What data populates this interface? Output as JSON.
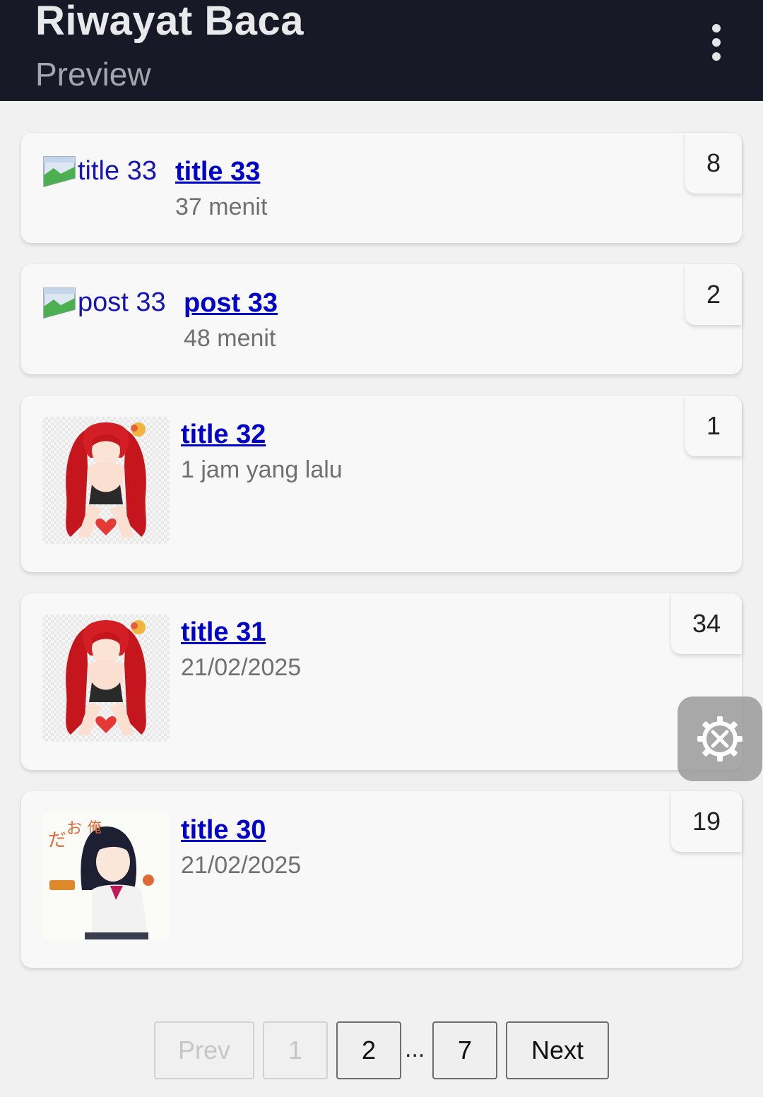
{
  "header": {
    "title": "Riwayat Baca",
    "subtitle": "Preview",
    "menu_icon": "more-vertical-icon"
  },
  "history": [
    {
      "title": "title 33",
      "image_alt": "title 33",
      "image_state": "broken",
      "time": "37 menit",
      "count": "8"
    },
    {
      "title": "post 33",
      "image_alt": "post 33",
      "image_state": "broken",
      "time": "48 menit",
      "count": "2"
    },
    {
      "title": "title 32",
      "image_state": "loaded",
      "time": "1 jam yang lalu",
      "count": "1"
    },
    {
      "title": "title 31",
      "image_state": "loaded",
      "time": "21/02/2025",
      "count": "34"
    },
    {
      "title": "title 30",
      "image_state": "loaded",
      "time": "21/02/2025",
      "count": "19"
    }
  ],
  "floating_button": {
    "icon": "settings-tools-icon"
  },
  "pagination": {
    "prev": "Prev",
    "first": "1",
    "page2": "2",
    "ellipsis": "...",
    "last": "7",
    "next": "Next",
    "current_page": "1"
  },
  "colors": {
    "header_bg": "#171a26",
    "link": "#0000cc",
    "muted_text": "#707070",
    "page_bg": "#f1f1f1"
  }
}
